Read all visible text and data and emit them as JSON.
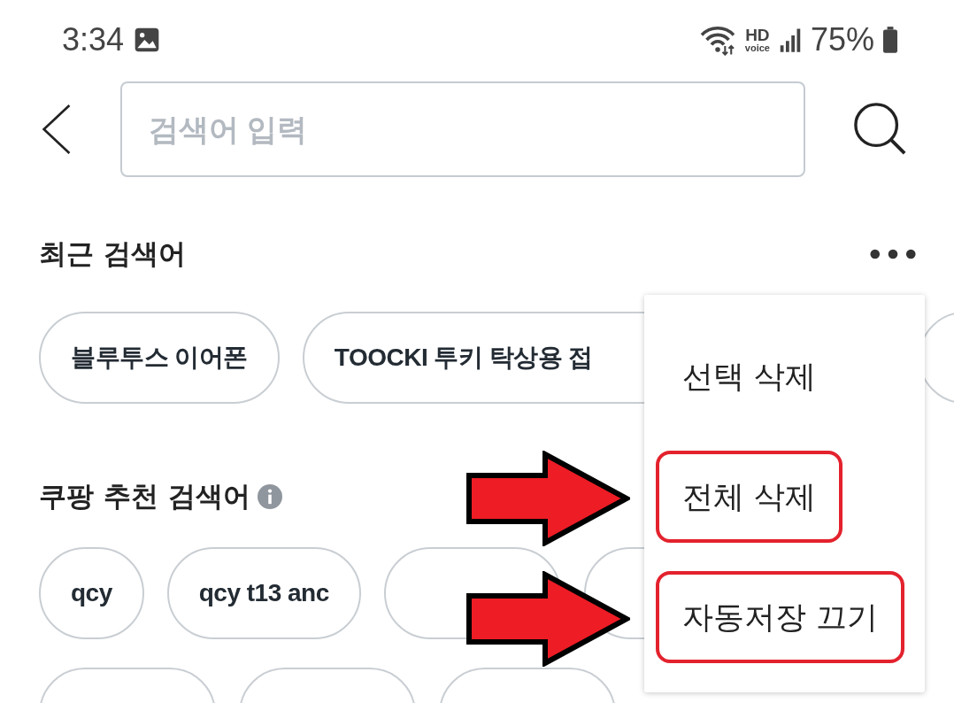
{
  "status_bar": {
    "time": "3:34",
    "hd": "HD",
    "voice": "voice",
    "battery": "75%"
  },
  "search": {
    "placeholder": "검색어 입력"
  },
  "recent": {
    "title": "최근 검색어",
    "chips": [
      {
        "label": "블루투스 이어폰"
      },
      {
        "label": "TOOCKI 투키 탁상용 접"
      },
      {
        "kind": "hidden"
      }
    ]
  },
  "recommended": {
    "title": "쿠팡 추천 검색어",
    "rows": [
      [
        {
          "label": "qcy"
        },
        {
          "label": "qcy t13 anc"
        },
        {
          "kind": "hidden"
        },
        {
          "kind": "hidden"
        }
      ],
      [
        {
          "kind": "hidden"
        },
        {
          "kind": "hidden"
        },
        {
          "kind": "hidden"
        }
      ]
    ]
  },
  "menu": {
    "items": [
      {
        "label": "선택 삭제",
        "highlighted": false
      },
      {
        "label": "전체 삭제",
        "highlighted": true
      },
      {
        "label": "자동저장 끄기",
        "highlighted": true
      }
    ]
  }
}
